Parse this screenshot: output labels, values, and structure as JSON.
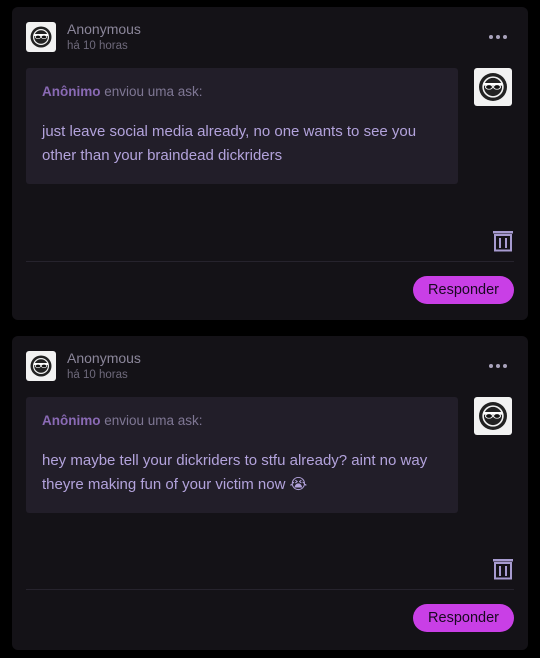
{
  "asks": [
    {
      "author": "Anonymous",
      "time": "há 10 horas",
      "ask_from": "Anônimo",
      "ask_suffix": " enviou uma ask:",
      "message": "just leave social media already, no one wants to see you other than your braindead dickriders",
      "reply_label": "Responder",
      "avatar_icon": "sunglasses-face-icon",
      "more_icon": "more-options-icon",
      "delete_icon": "trash-icon"
    },
    {
      "author": "Anonymous",
      "time": "há 10 horas",
      "ask_from": "Anônimo",
      "ask_suffix": " enviou uma ask:",
      "message": "hey maybe tell your dickriders to stfu already? aint no way theyre making fun of your victim now 😭",
      "reply_label": "Responder",
      "avatar_icon": "sunglasses-face-icon",
      "more_icon": "more-options-icon",
      "delete_icon": "trash-icon"
    }
  ],
  "colors": {
    "background": "#000000",
    "card": "#141217",
    "ask_box": "#221e29",
    "accent": "#c93fe6",
    "ask_text": "#b3a3dc"
  }
}
